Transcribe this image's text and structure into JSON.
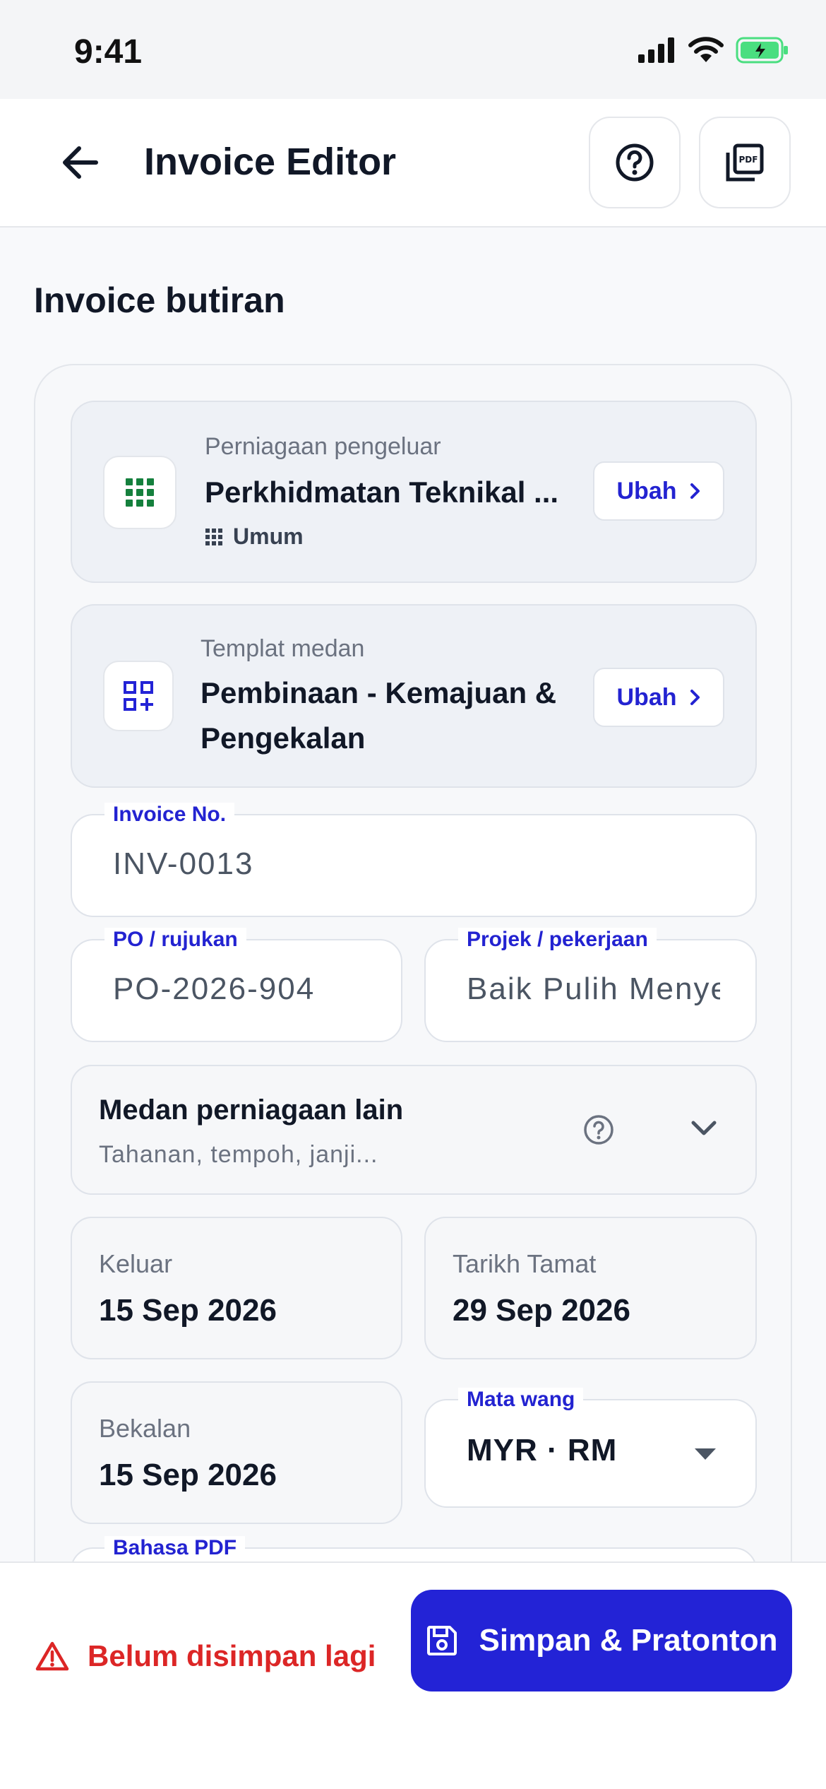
{
  "status_bar": {
    "time": "9:41"
  },
  "app_bar": {
    "title": "Invoice Editor"
  },
  "section": {
    "title": "Invoice butiran"
  },
  "business": {
    "caption": "Perniagaan pengeluar",
    "name": "Perkhidmatan Teknikal ...",
    "category": "Umum",
    "change_label": "Ubah"
  },
  "template": {
    "caption": "Templat medan",
    "name_line1": "Pembinaan - Kemajuan &",
    "name_line2": "Pengekalan",
    "change_label": "Ubah"
  },
  "fields": {
    "invoice_no": {
      "label": "Invoice No.",
      "value": "INV-0013"
    },
    "po": {
      "label": "PO / rujukan",
      "value": "PO-2026-904"
    },
    "project": {
      "label": "Projek / pekerjaan",
      "value": "Baik Pulih Menyelenggara"
    }
  },
  "other_fields": {
    "title": "Medan perniagaan lain",
    "subtitle": "Tahanan, tempoh, janji..."
  },
  "dates": {
    "issued": {
      "label": "Keluar",
      "value": "15 Sep 2026"
    },
    "due": {
      "label": "Tarikh Tamat",
      "value": "29 Sep 2026"
    },
    "supply": {
      "label": "Bekalan",
      "value": "15 Sep 2026"
    }
  },
  "currency": {
    "label": "Mata wang",
    "value": "MYR · RM"
  },
  "pdf_language": {
    "label": "Bahasa PDF"
  },
  "footer": {
    "unsaved": "Belum disimpan lagi",
    "save_label": "Simpan & Pratonton"
  },
  "colors": {
    "accent": "#2323d6",
    "warning": "#dc2626",
    "business_icon": "#15803d"
  }
}
